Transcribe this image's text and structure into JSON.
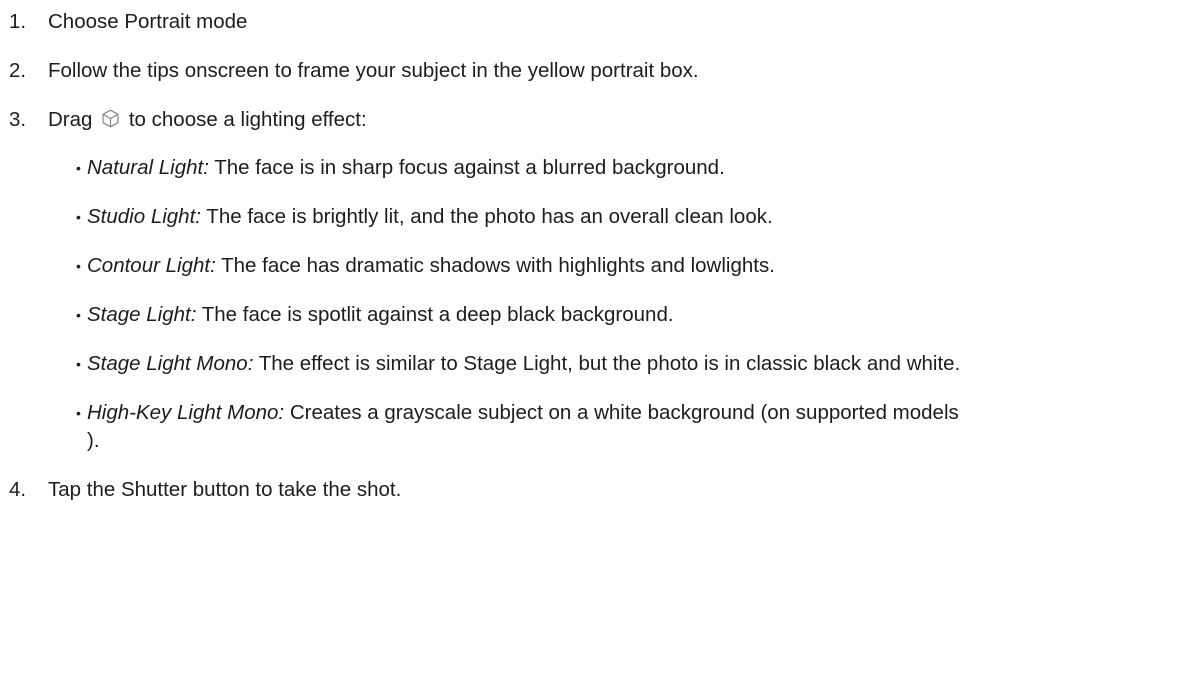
{
  "steps": [
    {
      "num": "1.",
      "text": "Choose Portrait mode"
    },
    {
      "num": "2.",
      "text": "Follow the tips onscreen to frame your subject in the yellow portrait box."
    },
    {
      "num": "3.",
      "text_before_icon": "Drag",
      "icon": "cube-icon",
      "text_after_icon": "to choose a lighting effect:"
    },
    {
      "num": "4.",
      "text": "Tap the Shutter button to take the shot."
    }
  ],
  "effects": [
    {
      "name": "Natural Light:",
      "desc": " The face is in sharp focus against a blurred background."
    },
    {
      "name": "Studio Light:",
      "desc": " The face is brightly lit, and the photo has an overall clean look."
    },
    {
      "name": "Contour Light:",
      "desc": " The face has dramatic shadows with highlights and lowlights."
    },
    {
      "name": "Stage Light:",
      "desc": " The face is spotlit against a deep black background."
    },
    {
      "name": "Stage Light Mono:",
      "desc": " The effect is similar to Stage Light, but the photo is in classic black and white."
    },
    {
      "name": "High-Key Light Mono:",
      "desc": " Creates a grayscale subject on a white background (on supported models )."
    }
  ],
  "bullet_glyph": "•",
  "colors": {
    "text": "#1d1d1f",
    "icon": "#86868b"
  }
}
